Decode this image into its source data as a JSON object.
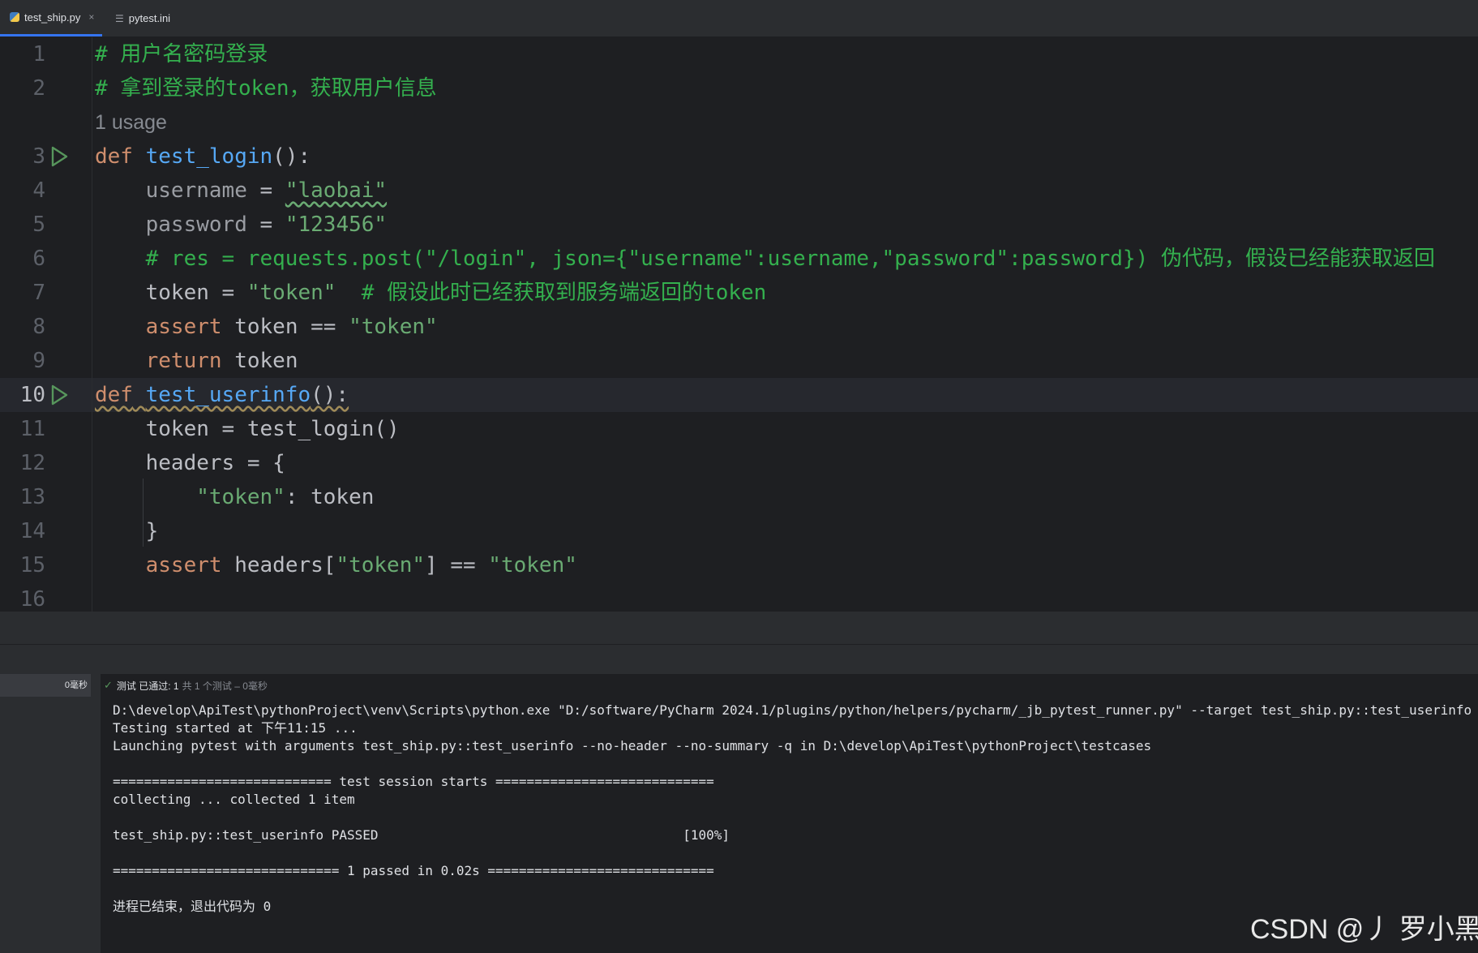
{
  "tabs": [
    {
      "label": "test_ship.py",
      "icon": "python-file-icon",
      "active": true,
      "close": "×"
    },
    {
      "label": "pytest.ini",
      "icon": "ini-file-icon",
      "active": false
    }
  ],
  "editor": {
    "line_numbers": [
      "1",
      "2",
      "3",
      "4",
      "5",
      "6",
      "7",
      "8",
      "9",
      "10",
      "11",
      "12",
      "13",
      "14",
      "15",
      "16"
    ],
    "usage_hint": "1 usage",
    "lines": {
      "l1_comment": "# 用户名密码登录",
      "l2_comment": "# 拿到登录的token，获取用户信息",
      "l3_def": "def",
      "l3_name": "test_login",
      "l3_rest": "():",
      "l4_var": "username",
      "l4_eq": " = ",
      "l4_val": "\"laobai\"",
      "l5_var": "password",
      "l5_eq": " = ",
      "l5_val": "\"123456\"",
      "l6_comment": "# res = requests.post(\"/login\", json={\"username\":username,\"password\":password}) 伪代码，假设已经能获取返回",
      "l7_code": "token = ",
      "l7_val": "\"token\"",
      "l7_comment": "  # 假设此时已经获取到服务端返回的token",
      "l8_kw": "assert",
      "l8_code": " token == ",
      "l8_val": "\"token\"",
      "l9_kw": "return",
      "l9_code": " token",
      "l10_def": "def",
      "l10_name": "test_userinfo",
      "l10_rest": "():",
      "l11_code": "token = test_login()",
      "l12_code": "headers = {",
      "l13_key": "\"token\"",
      "l13_rest": ": token",
      "l14_code": "}",
      "l15_kw": "assert",
      "l15_code1": " headers[",
      "l15_key": "\"token\"",
      "l15_code2": "] == ",
      "l15_val": "\"token\""
    }
  },
  "run_panel": {
    "tree_item_time": "0毫秒",
    "status_label": "测试 已通过: 1",
    "status_detail": "共 1 个测试 – 0毫秒",
    "output": [
      "D:\\develop\\ApiTest\\pythonProject\\venv\\Scripts\\python.exe \"D:/software/PyCharm 2024.1/plugins/python/helpers/pycharm/_jb_pytest_runner.py\" --target test_ship.py::test_userinfo",
      "Testing started at 下午11:15 ...",
      "Launching pytest with arguments test_ship.py::test_userinfo --no-header --no-summary -q in D:\\develop\\ApiTest\\pythonProject\\testcases",
      "",
      "============================ test session starts ============================",
      "collecting ... collected 1 item",
      "",
      "test_ship.py::test_userinfo PASSED                                       [100%]",
      "",
      "============================= 1 passed in 0.02s =============================",
      "",
      "进程已结束，退出代码为 0"
    ]
  },
  "watermark": "CSDN @丿 罗小黑",
  "colors": {
    "background": "#1e1f22",
    "keyword": "#cf8e6d",
    "function": "#56a8f5",
    "string": "#6aab73",
    "comment": "#34b04e",
    "run_icon": "#57965c"
  }
}
